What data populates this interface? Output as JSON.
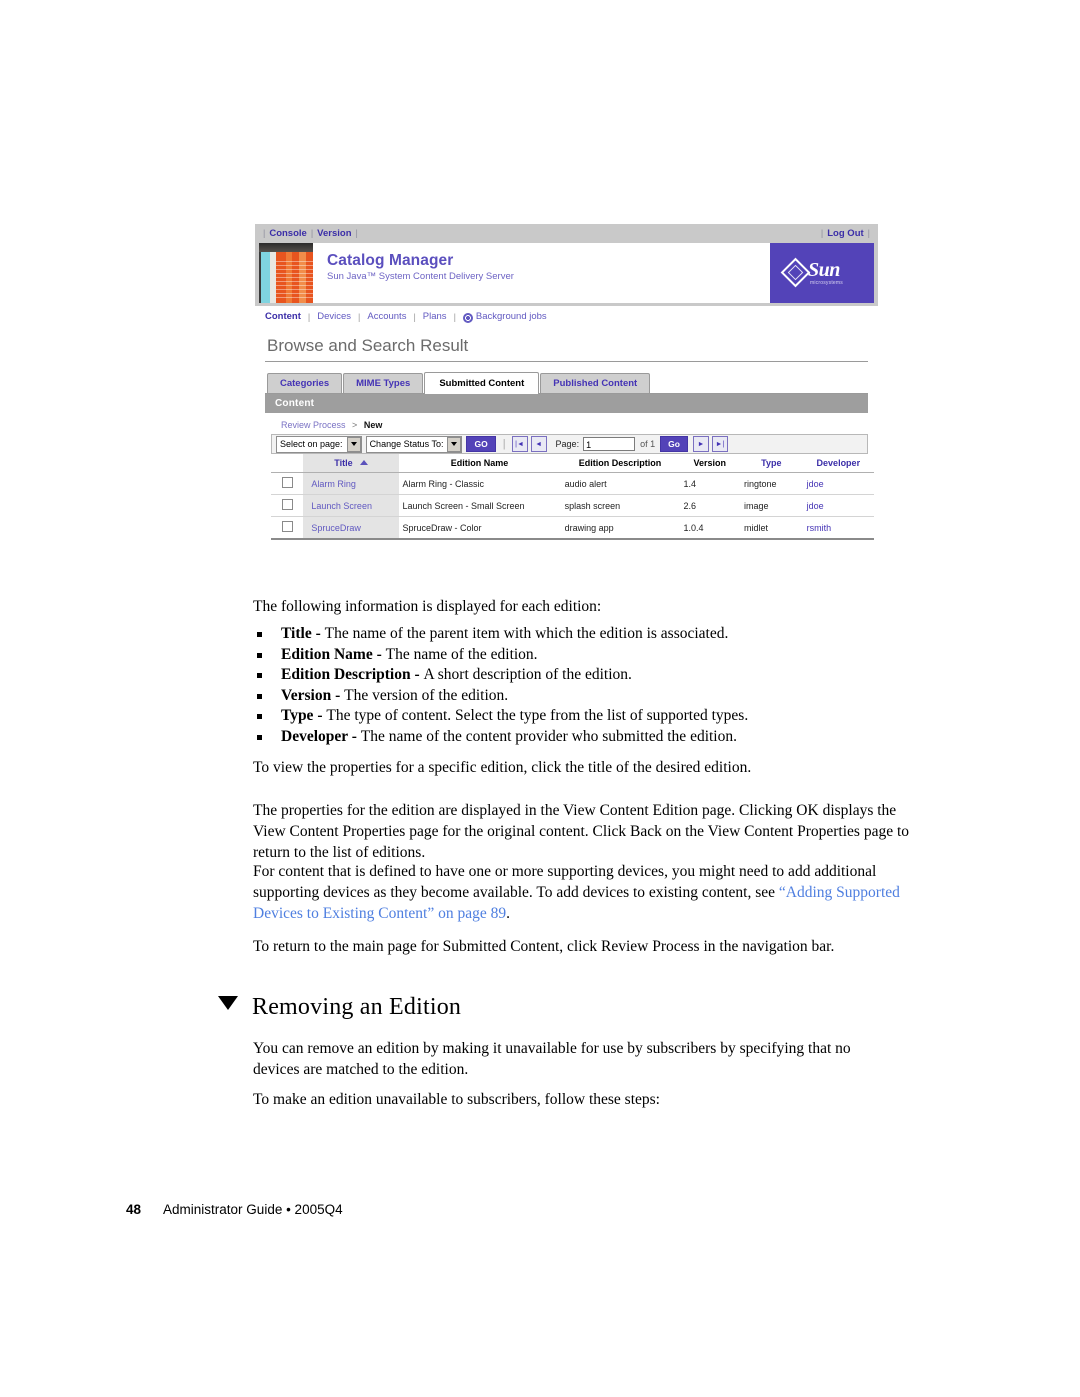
{
  "screenshot": {
    "topbar": {
      "console": "Console",
      "version": "Version",
      "logout": "Log Out"
    },
    "banner": {
      "title": "Catalog Manager",
      "subtitle": "Sun Java™ System Content Delivery Server",
      "logo_word": "Sun",
      "logo_sub": "microsystems"
    },
    "nav": {
      "items": [
        {
          "label": "Content",
          "active": true
        },
        {
          "label": "Devices",
          "active": false
        },
        {
          "label": "Accounts",
          "active": false
        },
        {
          "label": "Plans",
          "active": false
        },
        {
          "label": "Background jobs",
          "active": false
        }
      ]
    },
    "page_heading": "Browse and Search Result",
    "tabs": [
      {
        "label": "Categories",
        "active": false
      },
      {
        "label": "MIME Types",
        "active": false
      },
      {
        "label": "Submitted Content",
        "active": true
      },
      {
        "label": "Published Content",
        "active": false
      }
    ],
    "section_bar": "Content",
    "breadcrumb": {
      "parent": "Review Process",
      "separator": ">",
      "current": "New"
    },
    "toolbar": {
      "select_on_page": "Select on page:",
      "change_status_to": "Change Status To:",
      "go_button": "GO",
      "page_label": "Page:",
      "page_value": "1",
      "of_label": "of 1",
      "page_go_button": "Go",
      "first_icon": "first-page-icon",
      "prev_icon": "previous-page-icon",
      "next_icon": "next-page-icon",
      "last_icon": "last-page-icon"
    },
    "table": {
      "columns": [
        {
          "label": "",
          "key": "checkbox"
        },
        {
          "label": "Title",
          "key": "title",
          "sorted": true,
          "sort_dir": "asc"
        },
        {
          "label": "Edition Name",
          "key": "edition_name"
        },
        {
          "label": "Edition Description",
          "key": "edition_description"
        },
        {
          "label": "Version",
          "key": "version"
        },
        {
          "label": "Type",
          "key": "type"
        },
        {
          "label": "Developer",
          "key": "developer"
        }
      ],
      "rows": [
        {
          "title": "Alarm Ring",
          "edition_name": "Alarm Ring - Classic",
          "edition_description": "audio alert",
          "version": "1.4",
          "type": "ringtone",
          "developer": "jdoe"
        },
        {
          "title": "Launch Screen",
          "edition_name": "Launch Screen - Small Screen",
          "edition_description": "splash screen",
          "version": "2.6",
          "type": "image",
          "developer": "jdoe"
        },
        {
          "title": "SpruceDraw",
          "edition_name": "SpruceDraw - Color",
          "edition_description": "drawing app",
          "version": "1.0.4",
          "type": "midlet",
          "developer": "rsmith"
        }
      ]
    },
    "colors": {
      "accent_purple": "#5343b8",
      "link_purple": "#6159c1",
      "chrome_grey": "#c9c9c9",
      "section_bar_grey": "#9e9e9e"
    }
  },
  "document": {
    "intro": "The following information is displayed for each edition:",
    "bullets": [
      {
        "term": "Title - ",
        "text": "The name of the parent item with which the edition is associated."
      },
      {
        "term": "Edition Name - ",
        "text": "The name of the edition."
      },
      {
        "term": "Edition Description - ",
        "text": "A short description of the edition."
      },
      {
        "term": "Version - ",
        "text": "The version of the edition."
      },
      {
        "term": "Type - ",
        "text": "The type of content. Select the type from the list of supported types."
      },
      {
        "term": "Developer - ",
        "text": "The name of the content provider who submitted the edition."
      }
    ],
    "para_view": "To view the properties for a specific edition, click the title of the desired edition.",
    "para_properties": "The properties for the edition are displayed in the View Content Edition page. Clicking OK displays the View Content Properties page for the original content. Click Back on the View Content Properties page to return to the list of editions.",
    "para_devices_pre": "For content that is defined to have one or more supporting devices, you might need to add additional supporting devices as they become available. To add devices to existing content, see ",
    "para_devices_link": "“Adding Supported Devices to Existing Content” on page 89",
    "para_devices_post": ".",
    "para_return": "To return to the main page for Submitted Content, click Review Process in the navigation bar.",
    "section_title": "Removing an Edition",
    "para_remove": "You can remove an edition by making it unavailable for use by subscribers by specifying that no devices are matched to the edition.",
    "para_steps": "To make an edition unavailable to subscribers, follow these steps:",
    "footer": {
      "page_number": "48",
      "text": "Administrator Guide • 2005Q4"
    }
  }
}
